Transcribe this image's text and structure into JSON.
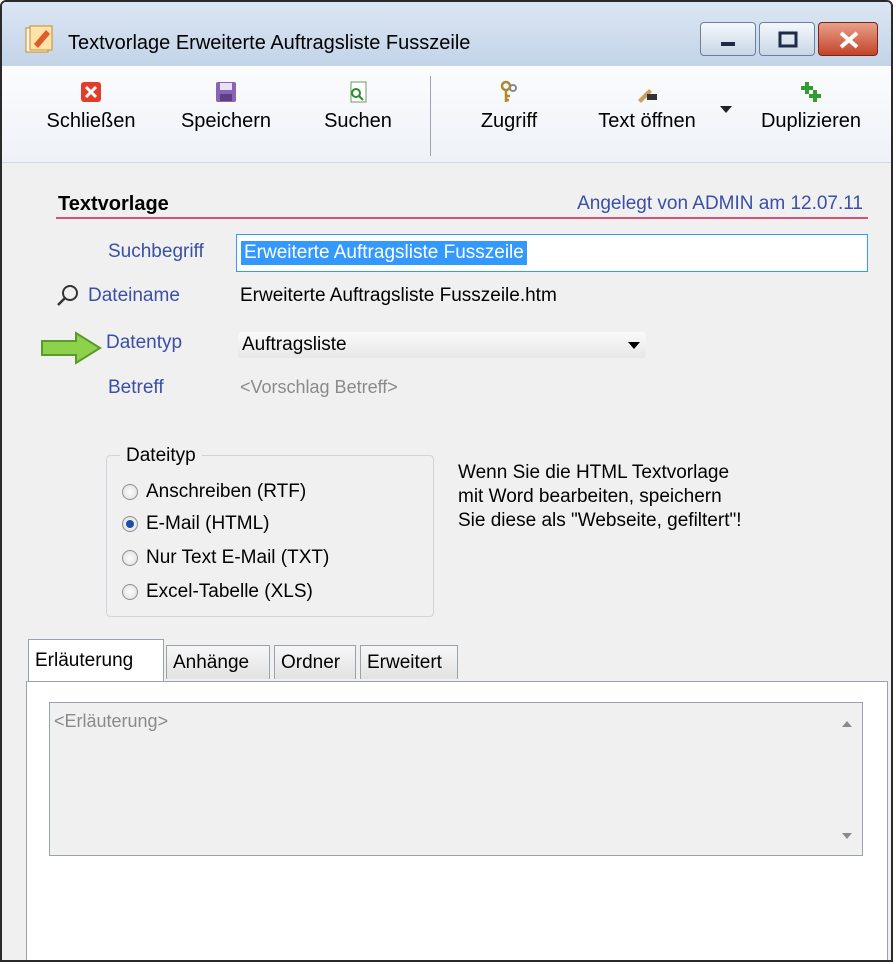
{
  "window": {
    "title": "Textvorlage Erweiterte Auftragsliste Fusszeile"
  },
  "toolbar": {
    "items": [
      {
        "label": "Schließen",
        "icon": "close-icon"
      },
      {
        "label": "Speichern",
        "icon": "save-icon"
      },
      {
        "label": "Suchen",
        "icon": "search-doc-icon"
      },
      {
        "label": "Zugriff",
        "icon": "keys-icon"
      },
      {
        "label": "Text öffnen",
        "icon": "pen-icon"
      },
      {
        "label": "Duplizieren",
        "icon": "duplicate-icon"
      }
    ]
  },
  "section": {
    "title": "Textvorlage",
    "meta": "Angelegt von ADMIN am 12.07.11"
  },
  "form": {
    "suchbegriff_label": "Suchbegriff",
    "suchbegriff_value": "Erweiterte Auftragsliste Fusszeile",
    "dateiname_label": "Dateiname",
    "dateiname_value": "Erweiterte Auftragsliste Fusszeile.htm",
    "datentyp_label": "Datentyp",
    "datentyp_value": "Auftragsliste",
    "betreff_label": "Betreff",
    "betreff_placeholder": "<Vorschlag Betreff>"
  },
  "dateityp": {
    "title": "Dateityp",
    "options": [
      {
        "label": "Anschreiben (RTF)",
        "selected": false
      },
      {
        "label": "E-Mail (HTML)",
        "selected": true
      },
      {
        "label": "Nur Text E-Mail (TXT)",
        "selected": false
      },
      {
        "label": "Excel-Tabelle (XLS)",
        "selected": false
      }
    ]
  },
  "note": {
    "line1": "Wenn Sie die HTML Textvorlage",
    "line2": "mit Word bearbeiten, speichern",
    "line3": "Sie diese als \"Webseite, gefiltert\"!"
  },
  "tabs": [
    "Erläuterung",
    "Anhänge",
    "Ordner",
    "Erweitert"
  ],
  "erlaeuterung": {
    "placeholder": "<Erläuterung>"
  },
  "colors": {
    "label_blue": "#3a4fa8",
    "section_line": "#d3527a",
    "selection": "#3399ff"
  }
}
